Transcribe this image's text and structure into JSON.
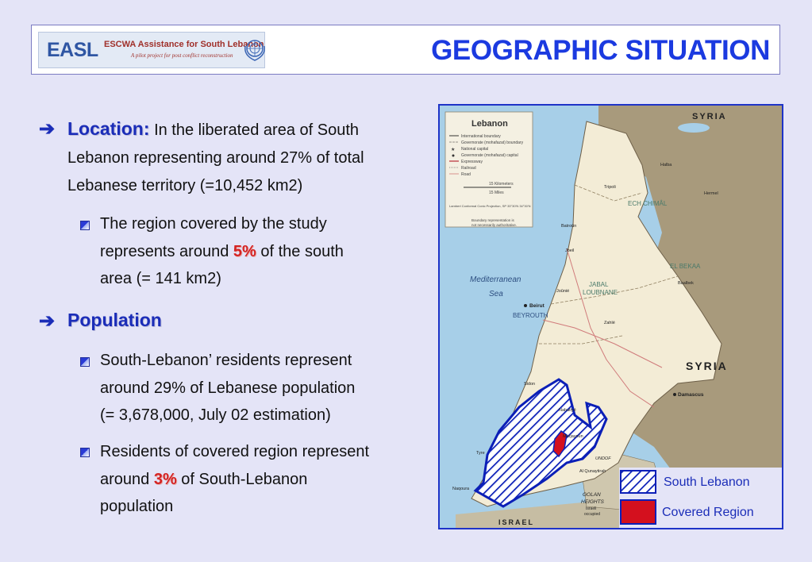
{
  "header": {
    "logo_main": "EASL",
    "logo_name": "ESCWA Assistance for South Lebanon",
    "logo_tagline": "A pilot project for post conflict reconstruction",
    "title": "GEOGRAPHIC SITUATION"
  },
  "location": {
    "heading": "Location:",
    "lines": [
      "In the liberated area of South",
      "Lebanon representing around 27% of total",
      "Lebanese territory (=10,452 km2)"
    ],
    "sub": {
      "line1": "The region covered by the study",
      "line2_pre": "represents around ",
      "line2_pct": "5%",
      "line2_post": " of the south",
      "line3": "area (= 141 km2)"
    }
  },
  "population": {
    "heading": "Population",
    "bullet1": [
      "South-Lebanon’ residents represent",
      "around 29% of Lebanese population",
      "(=  3,678,000, July 02 estimation)"
    ],
    "bullet2": {
      "line1": "Residents of covered region represent",
      "line2_pre": "around ",
      "line2_pct": "3%",
      "line2_post": " of South-Lebanon",
      "line3": "population"
    }
  },
  "map": {
    "legend_title": "Lebanon",
    "legend_items": [
      "International boundary",
      "Governorate (mohafazat) boundary",
      "National capital",
      "Governorate (mohafazat) capital",
      "Expressway",
      "Railroad",
      "Road"
    ],
    "scale_km": "15 Kilometers",
    "scale_mi": "15 Miles",
    "projection_note": "Lambert Conformal Conic Projection, SP 33°30'N 34°30'N",
    "boundary_note_1": "Boundary representation is",
    "boundary_note_2": "not necessarily authoritative.",
    "country_syria_top": "SYRIA",
    "country_syria_mid": "SYRIA",
    "country_israel": "ISRAEL",
    "sea_1": "Mediterranean",
    "sea_2": "Sea",
    "region_north": "ECH CHIMÂL",
    "region_bekaa": "EL BEKAA",
    "region_jabal_1": "JABAL",
    "region_jabal_2": "LOUBNANE",
    "golan_1": "GOLAN",
    "golan_2": "HEIGHTS",
    "golan_3": "Israeli",
    "golan_4": "occupied",
    "undof": "UNDOF",
    "city_beirut": "Beirut",
    "city_beyrouth": "BEYROUTH",
    "city_damascus": "Damascus",
    "city_tripoli": "Tripoli",
    "city_baalbek": "Baalbek",
    "city_zahle": "Zahlé",
    "city_saida": "Sidon",
    "city_tyre": "Tyre",
    "city_naqoura": "Naqoura",
    "city_halba": "Halba",
    "city_hermel": "Hermel",
    "city_batroun": "Batroûn",
    "city_jbeil": "Jbeil",
    "city_jounie": "Joûnié",
    "city_nabatiye": "Nabatiyé",
    "city_marjayoun": "Marjayoûn",
    "city_quneitra": "Al Qunaytirah",
    "legend_south": "South Lebanon",
    "legend_covered": "Covered Region",
    "colors": {
      "sea": "#a7cfe8",
      "lebanon": "#f3ecd6",
      "syria": "#a89a7c",
      "israel": "#c6bda3",
      "south_hatch": "#0b1fb7",
      "covered": "#d4101e"
    }
  }
}
